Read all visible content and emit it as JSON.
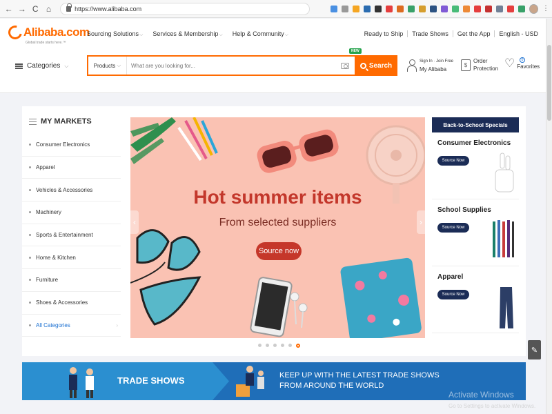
{
  "browser": {
    "url": "https://www.alibaba.com",
    "back": "←",
    "forward": "→",
    "reload": "C",
    "home": "⌂",
    "menu": "⋮"
  },
  "header": {
    "logo": "Alibaba.com",
    "logo_tag": "Global trade starts here.™",
    "nav": [
      "Sourcing Solutions",
      "Services & Membership",
      "Help & Community"
    ],
    "right_nav": [
      "Ready to Ship",
      "Trade Shows",
      "Get the App",
      "English - USD"
    ],
    "categories_label": "Categories",
    "search": {
      "type": "Products",
      "placeholder": "What are you looking for...",
      "button": "Search",
      "new_badge": "NEW"
    },
    "account": {
      "sign_in": "Sign In · Join Free",
      "my_alibaba": "My Alibaba"
    },
    "order": {
      "line1": "Order",
      "line2": "Protection"
    },
    "favorites": {
      "label": "Favorites",
      "count": "0"
    }
  },
  "markets": {
    "title": "MY MARKETS",
    "items": [
      "Consumer Electronics",
      "Apparel",
      "Vehicles & Accessories",
      "Machinery",
      "Sports & Entertainment",
      "Home & Kitchen",
      "Furniture",
      "Shoes & Accessories",
      "All Categories"
    ]
  },
  "banner": {
    "title": "Hot summer items",
    "subtitle": "From selected suppliers",
    "cta": "Source now",
    "slides": 6,
    "active_slide": 5,
    "bg": "#fac2b3"
  },
  "specials": {
    "header": "Back-to-School Specials",
    "cards": [
      {
        "title": "Consumer Electronics",
        "button": "Source Now"
      },
      {
        "title": "School Supplies",
        "button": "Source Now"
      },
      {
        "title": "Apparel",
        "button": "Source Now"
      }
    ]
  },
  "trade": {
    "title": "TRADE SHOWS",
    "line1": "KEEP UP WITH THE LATEST TRADE SHOWS",
    "line2": "FROM AROUND THE WORLD"
  },
  "watermark": {
    "title": "Activate Windows",
    "sub": "Go to Settings to activate Windows."
  },
  "colors": {
    "accent": "#ff6a00",
    "navy": "#1b2c56",
    "link": "#1a6fd1",
    "banner_text": "#c3372b",
    "trade_blue": "#1f6eb8"
  }
}
